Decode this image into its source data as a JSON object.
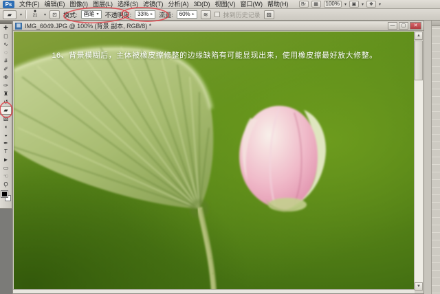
{
  "app": {
    "logo": "Ps"
  },
  "menu_bar": {
    "items": [
      "文件(F)",
      "编辑(E)",
      "图像(I)",
      "图层(L)",
      "选择(S)",
      "滤镜(T)",
      "分析(A)",
      "3D(D)",
      "视图(V)",
      "窗口(W)",
      "帮助(H)"
    ]
  },
  "app_bar": {
    "zoom_level": "100%",
    "icons": [
      {
        "name": "bridge-icon",
        "glyph": "Br"
      },
      {
        "name": "view-extras-icon",
        "glyph": "▦"
      },
      {
        "name": "arrange-documents-icon",
        "glyph": "▣"
      },
      {
        "name": "screen-mode-icon",
        "glyph": "❖"
      }
    ],
    "dropdown_caret": "▾"
  },
  "options_bar": {
    "tool_preview_glyph": "▰",
    "brush_dot": "●",
    "brush_size": "21",
    "toggle_panel_glyph": "⊡",
    "mode_label": "模式:",
    "mode_value": "画笔",
    "opacity_label": "不透明度:",
    "opacity_value": "33%",
    "flow_label": "流量:",
    "flow_value": "60%",
    "airbrush_glyph": "≋",
    "erase_history_label": "抹到历史记录",
    "brushes_panel_glyph": "▨",
    "caret": "▾",
    "spinner": "▸"
  },
  "toolbar": {
    "tools": [
      {
        "name": "move-tool",
        "glyph": "✚"
      },
      {
        "name": "marquee-tool",
        "glyph": "◻"
      },
      {
        "name": "lasso-tool",
        "glyph": "∿"
      },
      {
        "name": "quick-selection-tool",
        "glyph": "◌"
      },
      {
        "name": "crop-tool",
        "glyph": "#"
      },
      {
        "name": "eyedropper-tool",
        "glyph": "✐"
      },
      {
        "name": "healing-brush-tool",
        "glyph": "✙"
      },
      {
        "name": "brush-tool",
        "glyph": "✑"
      },
      {
        "name": "clone-stamp-tool",
        "glyph": "♜"
      },
      {
        "name": "history-brush-tool",
        "glyph": "↺"
      },
      {
        "name": "eraser-tool",
        "glyph": "▰"
      },
      {
        "name": "gradient-tool",
        "glyph": "▧"
      },
      {
        "name": "blur-tool",
        "glyph": "◖"
      },
      {
        "name": "dodge-tool",
        "glyph": "◒"
      },
      {
        "name": "pen-tool",
        "glyph": "✒"
      },
      {
        "name": "type-tool",
        "glyph": "T"
      },
      {
        "name": "path-selection-tool",
        "glyph": "►"
      },
      {
        "name": "shape-tool",
        "glyph": "▭"
      },
      {
        "name": "hand-tool",
        "glyph": "☜"
      },
      {
        "name": "zoom-tool",
        "glyph": "Ϙ"
      }
    ]
  },
  "document": {
    "title": "IMG_6049.JPG @ 100% (背景 副本, RGB/8) *",
    "icon_glyph": "▦",
    "caption": "16、背景模糊后，主体被橡皮擦修整的边缘缺陷有可能显现出来，使用橡皮擦最好放大修整。",
    "window_buttons": {
      "minimize": "—",
      "maximize": "▢",
      "close": "✕"
    }
  },
  "scrollbar": {
    "up_glyph": "▲",
    "down_glyph": "▼"
  },
  "colors": {
    "annotation_red": "#e0474e",
    "ps_logo_blue": "#2d6eb5",
    "close_button_red": "#c04a4a",
    "photo_green": "#5d8b1b",
    "bud_pink": "#e89ab4"
  }
}
